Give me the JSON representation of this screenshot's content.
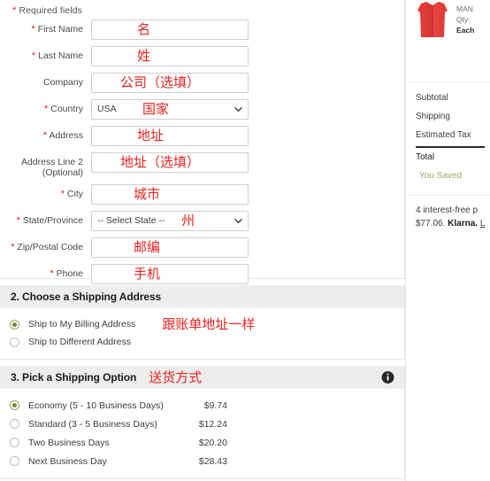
{
  "billing": {
    "required_note": "Required fields",
    "fields": [
      {
        "label": "First Name",
        "required": true,
        "type": "text",
        "value": "",
        "annotation": "名"
      },
      {
        "label": "Last Name",
        "required": true,
        "type": "text",
        "value": "",
        "annotation": "姓"
      },
      {
        "label": "Company",
        "required": false,
        "type": "text",
        "value": "",
        "annotation": "公司（选填）"
      },
      {
        "label": "Country",
        "required": true,
        "type": "select",
        "value": "USA",
        "annotation": "国家"
      },
      {
        "label": "Address",
        "required": true,
        "type": "text",
        "value": "",
        "annotation": "地址"
      },
      {
        "label": "Address Line 2\n(Optional)",
        "required": false,
        "type": "text",
        "value": "",
        "annotation": "地址（选填）"
      },
      {
        "label": "City",
        "required": true,
        "type": "text",
        "value": "",
        "annotation": "城市"
      },
      {
        "label": "State/Province",
        "required": true,
        "type": "select",
        "value": "-- Select State --",
        "annotation": "州"
      },
      {
        "label": "Zip/Postal Code",
        "required": true,
        "type": "text",
        "value": "",
        "annotation": "邮编"
      },
      {
        "label": "Phone",
        "required": true,
        "type": "text",
        "value": "",
        "annotation": "手机"
      }
    ]
  },
  "shipping_address": {
    "title": "2. Choose a Shipping Address",
    "annotation": "跟账单地址一样",
    "options": [
      {
        "label": "Ship to My Billing Address",
        "selected": true
      },
      {
        "label": "Ship to Different Address",
        "selected": false
      }
    ]
  },
  "shipping_option": {
    "title": "3. Pick a Shipping Option",
    "annotation": "送货方式",
    "info_icon": "info-circle-icon",
    "options": [
      {
        "label": "Economy (5 - 10 Business Days)",
        "price": "$9.74",
        "selected": true
      },
      {
        "label": "Standard (3 - 5 Business Days)",
        "price": "$12.24",
        "selected": false
      },
      {
        "label": "Two Business Days",
        "price": "$20.20",
        "selected": false
      },
      {
        "label": "Next Business Day",
        "price": "$28.43",
        "selected": false
      }
    ]
  },
  "summary": {
    "product": {
      "brand_line": "MAN",
      "qty_line": "Qty:",
      "each_line": "Each"
    },
    "rows": [
      {
        "label": "Subtotal"
      },
      {
        "label": "Shipping"
      },
      {
        "label": "Estimated Tax"
      }
    ],
    "total_label": "Total",
    "saved_label": "You Saved",
    "klarna_line1": "4 interest-free p",
    "klarna_amount": "$77.06.",
    "klarna_brand": "Klarna.",
    "klarna_link": "L"
  },
  "colors": {
    "required_asterisk": "#cc2b2b",
    "annotation_red": "#e8231f",
    "radio_selected": "#77872f",
    "section_header_bg": "#ededed",
    "saved_text": "#a8a35e",
    "product_red": "#e03c38"
  }
}
